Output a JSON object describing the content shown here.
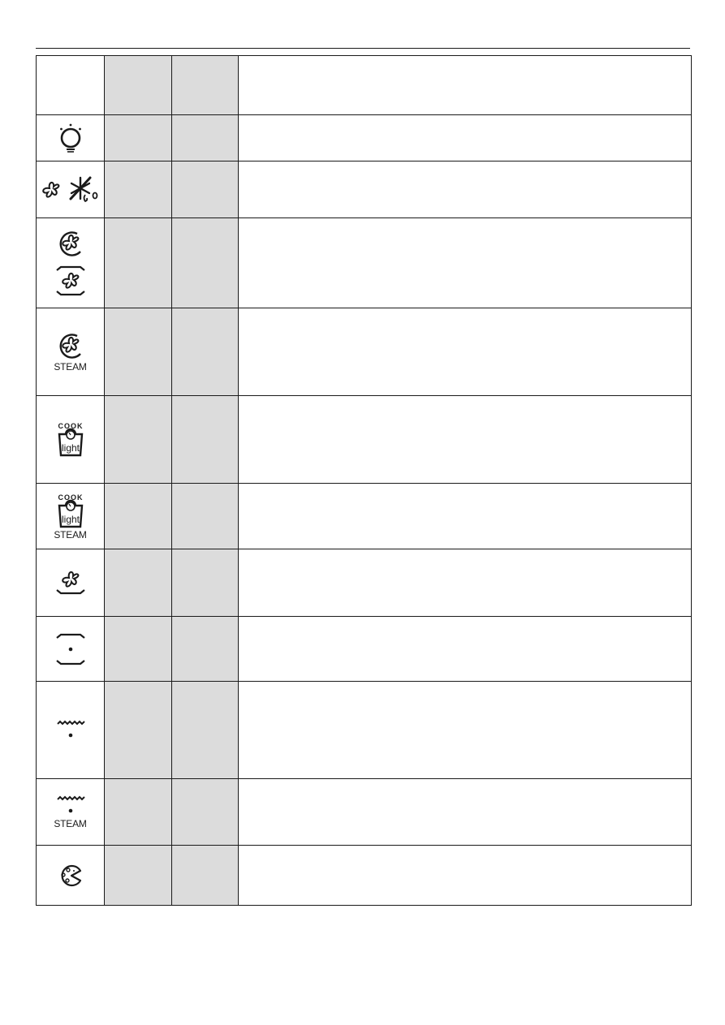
{
  "document": {
    "colors": {
      "rule": "#1a1a1a",
      "shaded_column": "#dcdcdc",
      "background": "#ffffff"
    },
    "table": {
      "rows": [
        {
          "icon": "none",
          "label": "",
          "col2": "",
          "col3": "",
          "description": ""
        },
        {
          "icon": "oven-lamp-icon",
          "label": "",
          "col2": "",
          "col3": "",
          "description": ""
        },
        {
          "icon": "fan-defrost-icon",
          "label": "",
          "col2": "",
          "col3": "",
          "description": ""
        },
        {
          "icon": "circular-fan-and-fan-top-bottom-icon",
          "label": "",
          "col2": "",
          "col3": "",
          "description": ""
        },
        {
          "icon": "circular-fan-steam-icon",
          "label": "STEAM",
          "col2": "",
          "col3": "",
          "description": ""
        },
        {
          "icon": "cook-light-icon",
          "label": "",
          "col2": "",
          "col3": "",
          "description": ""
        },
        {
          "icon": "cook-light-steam-icon",
          "label": "STEAM",
          "col2": "",
          "col3": "",
          "description": ""
        },
        {
          "icon": "fan-bottom-heat-icon",
          "label": "",
          "col2": "",
          "col3": "",
          "description": ""
        },
        {
          "icon": "top-bottom-heat-icon",
          "label": "",
          "col2": "",
          "col3": "",
          "description": ""
        },
        {
          "icon": "grill-icon",
          "label": "",
          "col2": "",
          "col3": "",
          "description": ""
        },
        {
          "icon": "grill-steam-icon",
          "label": "STEAM",
          "col2": "",
          "col3": "",
          "description": ""
        },
        {
          "icon": "pizza-icon",
          "label": "",
          "col2": "",
          "col3": "",
          "description": ""
        }
      ]
    }
  }
}
